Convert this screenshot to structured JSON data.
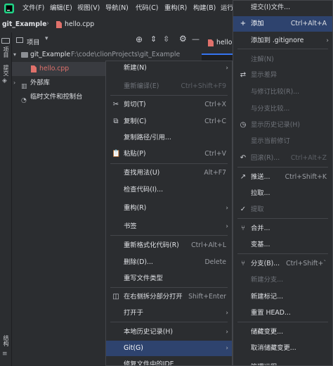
{
  "menubar": {
    "items": [
      "文件(F)",
      "编辑(E)",
      "视图(V)",
      "导航(N)",
      "代码(C)",
      "重构(R)",
      "构建(B)",
      "运行"
    ]
  },
  "projectbar": {
    "project": "git_Example",
    "file": "hello.cpp"
  },
  "toolwindow": {
    "title": "项目",
    "tab_label": "hello"
  },
  "leftstrip": {
    "project_label": "项目",
    "commit_label": "提交",
    "structure_label": "结构"
  },
  "tree": {
    "root_name": "git_Example",
    "root_path": "F:\\code\\clionProjects\\git_Example",
    "file": "hello.cpp",
    "external": "外部库",
    "scratches": "临时文件和控制台"
  },
  "menu1": [
    {
      "label": "新建(N)",
      "submenu": true
    },
    {
      "label": "重新编译(E)",
      "shortcut": "Ctrl+Shift+F9",
      "disabled": true
    },
    {
      "label": "剪切(T)",
      "shortcut": "Ctrl+X",
      "icon": "✂"
    },
    {
      "label": "复制(C)",
      "shortcut": "Ctrl+C",
      "icon": "⧉"
    },
    {
      "label": "复制路径/引用..."
    },
    {
      "label": "粘贴(P)",
      "shortcut": "Ctrl+V",
      "icon": "📋"
    },
    {
      "label": "查找用法(U)",
      "shortcut": "Alt+F7"
    },
    {
      "label": "检查代码(I)..."
    },
    {
      "label": "重构(R)",
      "submenu": true
    },
    {
      "label": "书签",
      "submenu": true
    },
    {
      "label": "重新格式化代码(R)",
      "shortcut": "Ctrl+Alt+L"
    },
    {
      "label": "删除(D)...",
      "shortcut": "Delete"
    },
    {
      "label": "重写文件类型"
    },
    {
      "label": "在右侧拆分部分打开",
      "shortcut": "Shift+Enter",
      "icon": "◫"
    },
    {
      "label": "打开于",
      "submenu": true
    },
    {
      "label": "本地历史记录(H)",
      "submenu": true
    },
    {
      "label": "Git(G)",
      "submenu": true,
      "selected": true
    },
    {
      "label": "修复文件中的IDE"
    }
  ],
  "menu2": [
    {
      "label": "提交(I)文件..."
    },
    {
      "label": "添加",
      "shortcut": "Ctrl+Alt+A",
      "icon": "+",
      "selected": true
    },
    {
      "label": "添加到 .gitignore",
      "submenu": true
    },
    {
      "label": "注解(N)",
      "disabled": true
    },
    {
      "label": "显示差异",
      "disabled": true,
      "icon": "⇄"
    },
    {
      "label": "与修订比较(R)...",
      "disabled": true
    },
    {
      "label": "与分支比较...",
      "disabled": true
    },
    {
      "label": "显示历史记录(H)",
      "disabled": true,
      "icon": "◷"
    },
    {
      "label": "显示当前修订",
      "disabled": true
    },
    {
      "label": "回滚(R)...",
      "shortcut": "Ctrl+Alt+Z",
      "disabled": true,
      "icon": "↶"
    },
    {
      "label": "推送...",
      "shortcut": "Ctrl+Shift+K",
      "icon": "↗"
    },
    {
      "label": "拉取..."
    },
    {
      "label": "提取",
      "disabled": true,
      "icon": "✓"
    },
    {
      "label": "合并...",
      "icon": "⑂"
    },
    {
      "label": "变基..."
    },
    {
      "label": "分支(B)...",
      "shortcut": "Ctrl+Shift+`",
      "icon": "⑂"
    },
    {
      "label": "新建分支...",
      "disabled": true
    },
    {
      "label": "新建标记..."
    },
    {
      "label": "重置 HEAD..."
    },
    {
      "label": "储藏变更..."
    },
    {
      "label": "取消储藏变更..."
    },
    {
      "label": "管理远程..."
    }
  ],
  "colors": {
    "accent": "#2e436e",
    "bg": "#2b2d30",
    "editor_bg": "#1e1f22",
    "file_red": "#e0716b",
    "folder": "#8c8f94"
  }
}
